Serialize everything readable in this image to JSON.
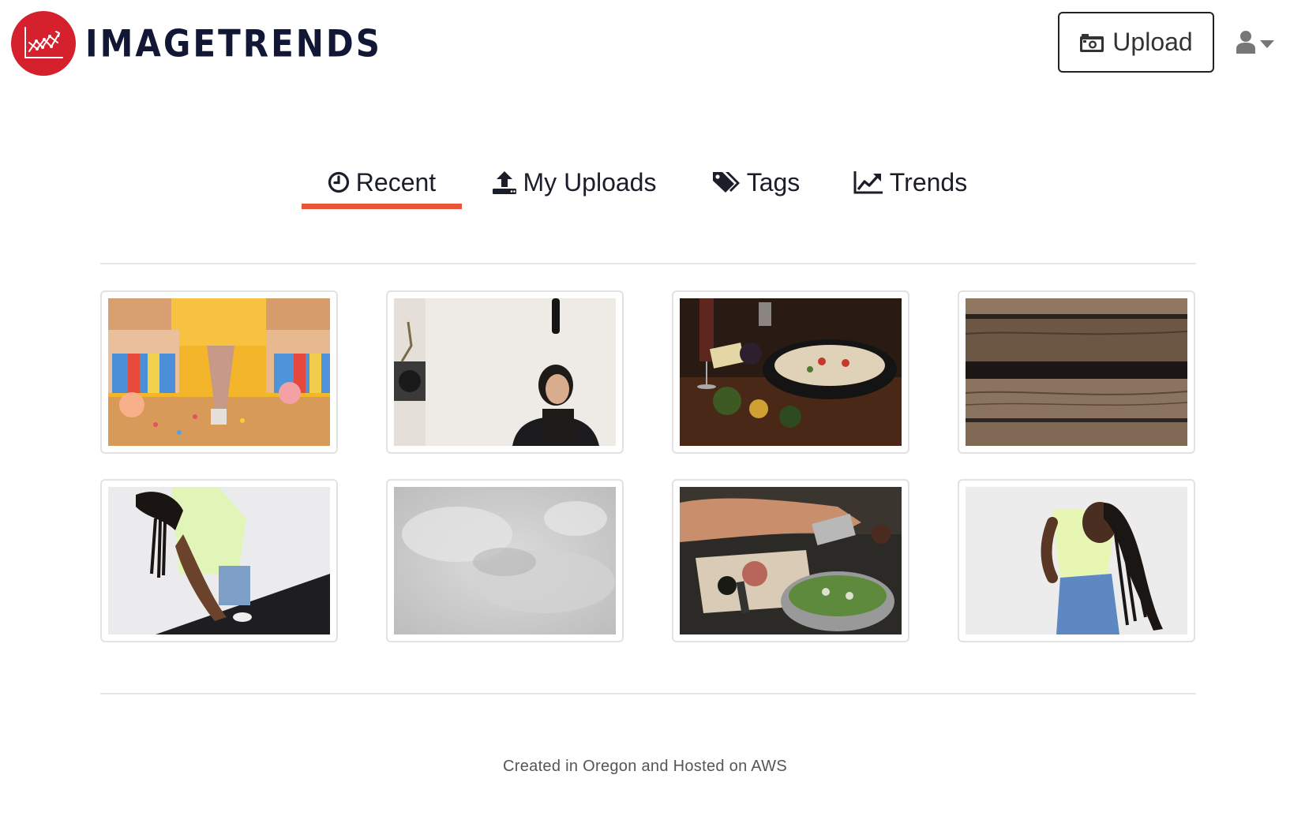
{
  "brand": {
    "name": "IMAGETRENDS",
    "color": "#d5202e"
  },
  "header": {
    "upload_label": "Upload",
    "upload_icon": "camera-icon",
    "user_icon": "user-icon"
  },
  "tabs": [
    {
      "label": "Recent",
      "icon": "clock-icon",
      "active": true
    },
    {
      "label": "My Uploads",
      "icon": "upload-icon",
      "active": false
    },
    {
      "label": "Tags",
      "icon": "tags-icon",
      "active": false
    },
    {
      "label": "Trends",
      "icon": "line-chart-icon",
      "active": false
    }
  ],
  "accent": "#e8553a",
  "images": [
    {
      "subject": "ice-cream-sundae-table"
    },
    {
      "subject": "woman-interview-camera"
    },
    {
      "subject": "dinner-table-pasta"
    },
    {
      "subject": "weathered-wood-planks"
    },
    {
      "subject": "woman-braids-wall"
    },
    {
      "subject": "gray-fur-texture"
    },
    {
      "subject": "grating-cheese-salad"
    },
    {
      "subject": "woman-braids-denim"
    }
  ],
  "footer": {
    "text": "Created in Oregon and Hosted on AWS"
  }
}
